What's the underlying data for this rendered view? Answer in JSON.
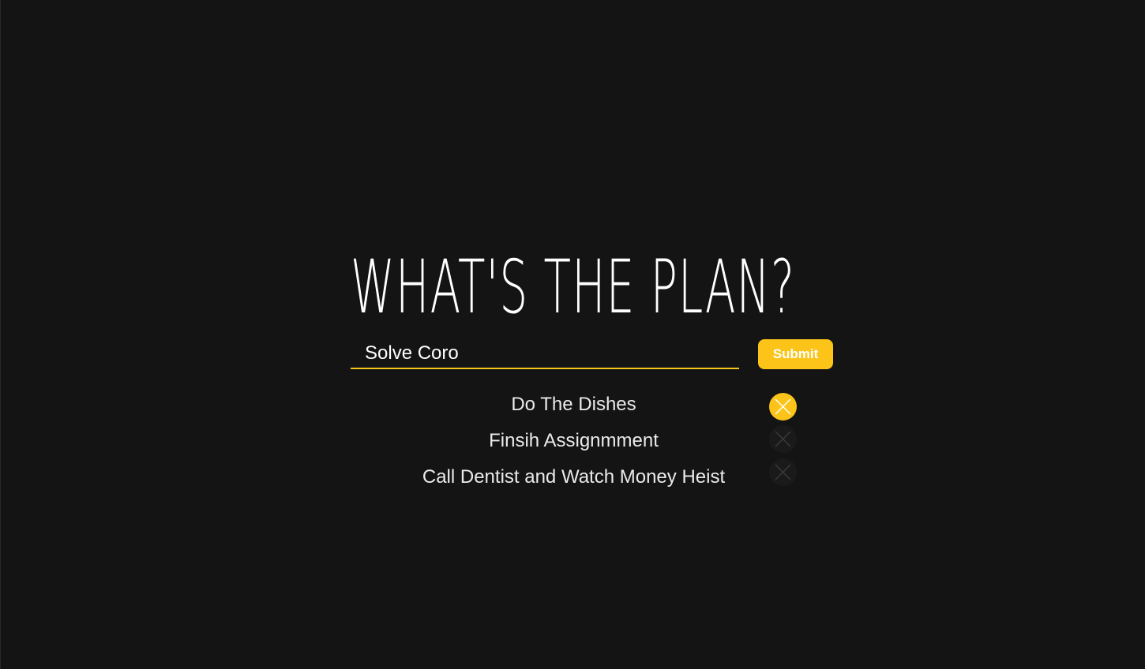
{
  "header": {
    "title": "WHAT'S THE PLAN?"
  },
  "form": {
    "input_value": "Solve Coro",
    "submit_label": "Submit"
  },
  "todos": [
    {
      "text": "Do The Dishes",
      "delete_icon": "close-icon",
      "highlighted": true
    },
    {
      "text": "Finsih Assignmment",
      "delete_icon": "close-icon",
      "highlighted": false
    },
    {
      "text": "Call Dentist and Watch Money Heist",
      "delete_icon": "close-icon",
      "highlighted": false
    }
  ],
  "colors": {
    "background": "#141414",
    "accent": "#fcc419",
    "text": "#ffffff"
  }
}
